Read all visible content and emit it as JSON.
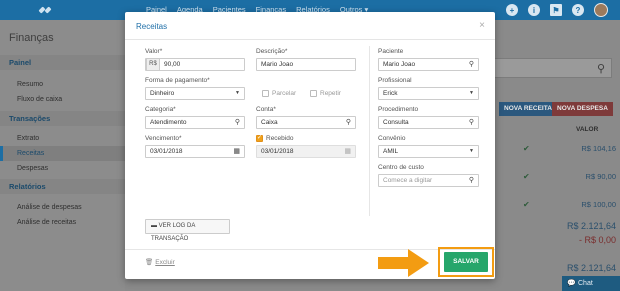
{
  "topbar": {
    "nav": [
      "Painel",
      "Agenda",
      "Pacientes",
      "Finanças",
      "Relatórios",
      "Outros ▾"
    ],
    "icons": [
      "plus-icon",
      "info-icon",
      "flag-icon",
      "help-icon",
      "avatar"
    ]
  },
  "sidebar": {
    "title": "Finanças",
    "sections": [
      {
        "heading": "Painel",
        "items": [
          "Resumo",
          "Fluxo de caixa"
        ]
      },
      {
        "heading": "Transações",
        "items": [
          "Extrato",
          "Receitas",
          "Despesas"
        ]
      },
      {
        "heading": "Relatórios",
        "items": [
          "Análise de despesas",
          "Análise de receitas"
        ]
      }
    ],
    "active_item": "Receitas"
  },
  "background": {
    "btn_nova_receita": "NOVA RECEITA",
    "btn_nova_despesa": "NOVA DESPESA",
    "col_valor": "VALOR",
    "values": [
      "R$ 104,16",
      "R$ 90,00",
      "R$ 100,00"
    ],
    "total_1": "R$ 2.121,64",
    "total_2": "- R$ 0,00",
    "total_3": "R$ 2.121,64",
    "total_4": "R$ 2.121,64",
    "chat": "Chat"
  },
  "modal": {
    "title": "Receitas",
    "close": "×",
    "valor_label": "Valor*",
    "valor_prefix": "R$",
    "valor": "90,00",
    "descricao_label": "Descrição*",
    "descricao": "Mario Joao",
    "forma_label": "Forma de pagamento*",
    "forma": "Dinheiro",
    "parcelar": "Parcelar",
    "repetir": "Repetir",
    "categoria_label": "Categoria*",
    "categoria": "Atendimento",
    "conta_label": "Conta*",
    "conta": "Caixa",
    "vencimento_label": "Vencimento*",
    "vencimento": "03/01/2018",
    "recebido_label": "Recebido",
    "recebido_date": "03/01/2018",
    "paciente_label": "Paciente",
    "paciente": "Mario Joao",
    "profissional_label": "Profissional",
    "profissional": "Erick",
    "procedimento_label": "Procedimento",
    "procedimento": "Consulta",
    "convenio_label": "Convênio",
    "convenio": "AMIL",
    "centro_label": "Centro de custo",
    "centro_placeholder": "Comece a digitar",
    "log_button": "VER LOG DA TRANSAÇÃO",
    "excluir": "Excluir",
    "salvar": "SALVAR"
  },
  "colors": {
    "brand": "#1c6ea4",
    "save": "#26a66b",
    "highlight": "#f39c12"
  }
}
